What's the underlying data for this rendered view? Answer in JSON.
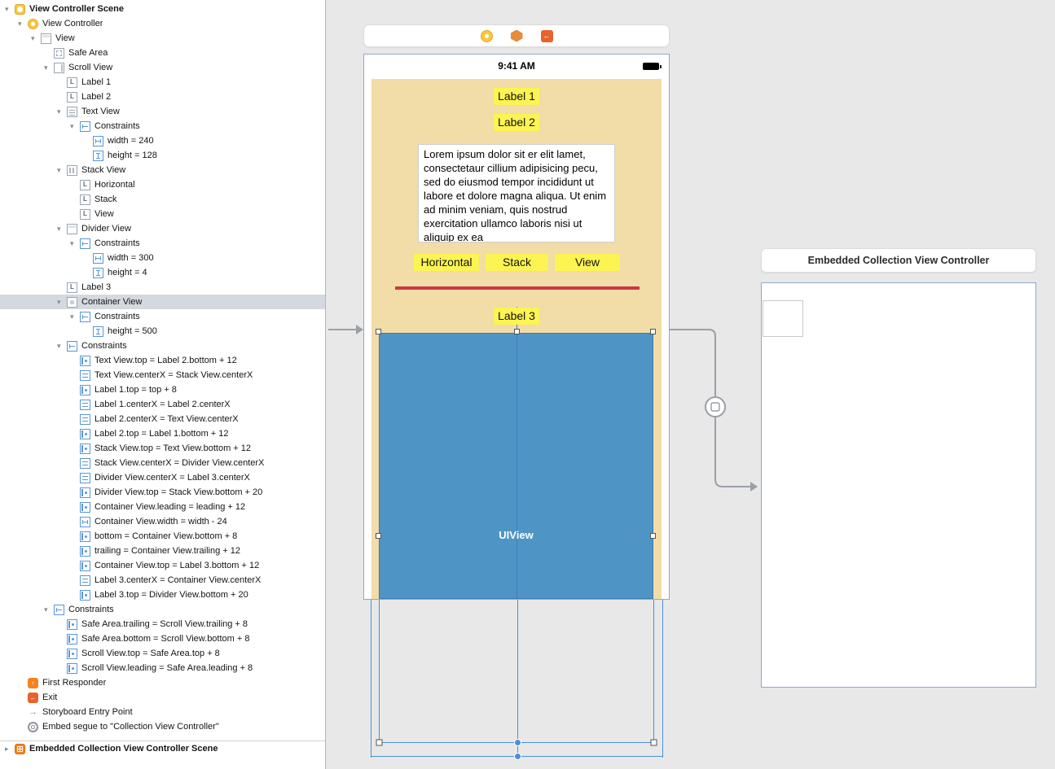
{
  "colors": {
    "canvas_bg": "#e8e8e8",
    "selection_bg": "#d4d9df",
    "content_tan": "#f2dca7",
    "label_yellow": "#fcf452",
    "container_blue": "#4e95c6",
    "divider_red": "#cd3745",
    "frame_border": "#8fa9cd",
    "constraint_blue": "#4a90d9",
    "segue_gray": "#9aa0a6"
  },
  "sidebar": {
    "rows": [
      {
        "label": "View Controller Scene",
        "lvl": 0,
        "icon": "scene-vc",
        "disc": "open",
        "bold": true
      },
      {
        "label": "View Controller",
        "lvl": 1,
        "icon": "vc",
        "disc": "open"
      },
      {
        "label": "View",
        "lvl": 2,
        "icon": "view",
        "disc": "open"
      },
      {
        "label": "Safe Area",
        "lvl": 3,
        "icon": "safearea",
        "disc": ""
      },
      {
        "label": "Scroll View",
        "lvl": 3,
        "icon": "scrollview",
        "disc": "open"
      },
      {
        "label": "Label 1",
        "lvl": 4,
        "icon": "label",
        "disc": ""
      },
      {
        "label": "Label 2",
        "lvl": 4,
        "icon": "label",
        "disc": ""
      },
      {
        "label": "Text View",
        "lvl": 4,
        "icon": "textview",
        "disc": "open"
      },
      {
        "label": "Constraints",
        "lvl": 5,
        "icon": "constraints",
        "disc": "open"
      },
      {
        "label": "width = 240",
        "lvl": 6,
        "icon": "size-w",
        "disc": ""
      },
      {
        "label": "height = 128",
        "lvl": 6,
        "icon": "size-h",
        "disc": ""
      },
      {
        "label": "Stack View",
        "lvl": 4,
        "icon": "stackview",
        "disc": "open"
      },
      {
        "label": "Horizontal",
        "lvl": 5,
        "icon": "label",
        "disc": ""
      },
      {
        "label": "Stack",
        "lvl": 5,
        "icon": "label",
        "disc": ""
      },
      {
        "label": "View",
        "lvl": 5,
        "icon": "label",
        "disc": ""
      },
      {
        "label": "Divider View",
        "lvl": 4,
        "icon": "view",
        "disc": "open"
      },
      {
        "label": "Constraints",
        "lvl": 5,
        "icon": "constraints",
        "disc": "open"
      },
      {
        "label": "width = 300",
        "lvl": 6,
        "icon": "size-w",
        "disc": ""
      },
      {
        "label": "height = 4",
        "lvl": 6,
        "icon": "size-h",
        "disc": ""
      },
      {
        "label": "Label 3",
        "lvl": 4,
        "icon": "label",
        "disc": ""
      },
      {
        "label": "Container View",
        "lvl": 4,
        "icon": "container",
        "disc": "open",
        "sel": true
      },
      {
        "label": "Constraints",
        "lvl": 5,
        "icon": "constraints",
        "disc": "open"
      },
      {
        "label": "height = 500",
        "lvl": 6,
        "icon": "size-h",
        "disc": ""
      },
      {
        "label": "Constraints",
        "lvl": 4,
        "icon": "constraints",
        "disc": "open"
      },
      {
        "label": "Text View.top = Label 2.bottom + 12",
        "lvl": 5,
        "icon": "pin",
        "disc": ""
      },
      {
        "label": "Text View.centerX = Stack View.centerX",
        "lvl": 5,
        "icon": "align",
        "disc": ""
      },
      {
        "label": "Label 1.top = top + 8",
        "lvl": 5,
        "icon": "pin",
        "disc": ""
      },
      {
        "label": "Label 1.centerX = Label 2.centerX",
        "lvl": 5,
        "icon": "align",
        "disc": ""
      },
      {
        "label": "Label 2.centerX = Text View.centerX",
        "lvl": 5,
        "icon": "align",
        "disc": ""
      },
      {
        "label": "Label 2.top = Label 1.bottom + 12",
        "lvl": 5,
        "icon": "pin",
        "disc": ""
      },
      {
        "label": "Stack View.top = Text View.bottom + 12",
        "lvl": 5,
        "icon": "pin",
        "disc": ""
      },
      {
        "label": "Stack View.centerX = Divider View.centerX",
        "lvl": 5,
        "icon": "align",
        "disc": ""
      },
      {
        "label": "Divider View.centerX = Label 3.centerX",
        "lvl": 5,
        "icon": "align",
        "disc": ""
      },
      {
        "label": "Divider View.top = Stack View.bottom + 20",
        "lvl": 5,
        "icon": "pin",
        "disc": ""
      },
      {
        "label": "Container View.leading = leading + 12",
        "lvl": 5,
        "icon": "pin",
        "disc": ""
      },
      {
        "label": "Container View.width = width - 24",
        "lvl": 5,
        "icon": "size-w",
        "disc": ""
      },
      {
        "label": "bottom = Container View.bottom + 8",
        "lvl": 5,
        "icon": "pin",
        "disc": ""
      },
      {
        "label": "trailing = Container View.trailing + 12",
        "lvl": 5,
        "icon": "pin",
        "disc": ""
      },
      {
        "label": "Container View.top = Label 3.bottom + 12",
        "lvl": 5,
        "icon": "pin",
        "disc": ""
      },
      {
        "label": "Label 3.centerX = Container View.centerX",
        "lvl": 5,
        "icon": "align",
        "disc": ""
      },
      {
        "label": "Label 3.top = Divider View.bottom + 20",
        "lvl": 5,
        "icon": "pin",
        "disc": ""
      },
      {
        "label": "Constraints",
        "lvl": 3,
        "icon": "constraints",
        "disc": "open"
      },
      {
        "label": "Safe Area.trailing = Scroll View.trailing + 8",
        "lvl": 4,
        "icon": "pin",
        "disc": ""
      },
      {
        "label": "Safe Area.bottom = Scroll View.bottom + 8",
        "lvl": 4,
        "icon": "pin",
        "disc": ""
      },
      {
        "label": "Scroll View.top = Safe Area.top + 8",
        "lvl": 4,
        "icon": "pin",
        "disc": ""
      },
      {
        "label": "Scroll View.leading = Safe Area.leading + 8",
        "lvl": 4,
        "icon": "pin",
        "disc": ""
      },
      {
        "label": "First Responder",
        "lvl": 1,
        "icon": "responder",
        "disc": ""
      },
      {
        "label": "Exit",
        "lvl": 1,
        "icon": "exit",
        "disc": ""
      },
      {
        "label": "Storyboard Entry Point",
        "lvl": 1,
        "icon": "entry",
        "disc": ""
      },
      {
        "label": "Embed segue to \"Collection View Controller\"",
        "lvl": 1,
        "icon": "segue",
        "disc": ""
      },
      {
        "label": "Embedded Collection View Controller Scene",
        "lvl": 0,
        "icon": "scene-cv",
        "disc": "closed",
        "bold": true,
        "sep": true
      }
    ]
  },
  "device": {
    "status_time": "9:41 AM",
    "label1": "Label 1",
    "label2": "Label 2",
    "text_view": "Lorem ipsum dolor sit er elit lamet, consectetaur cillium adipisicing pecu, sed do eiusmod tempor incididunt ut labore et dolore magna aliqua. Ut enim ad minim veniam, quis nostrud exercitation ullamco laboris nisi ut aliquip ex ea",
    "stack_labels": [
      "Horizontal",
      "Stack",
      "View"
    ],
    "label3": "Label 3",
    "container_label": "UIView"
  },
  "embedded": {
    "title": "Embedded Collection View Controller"
  }
}
